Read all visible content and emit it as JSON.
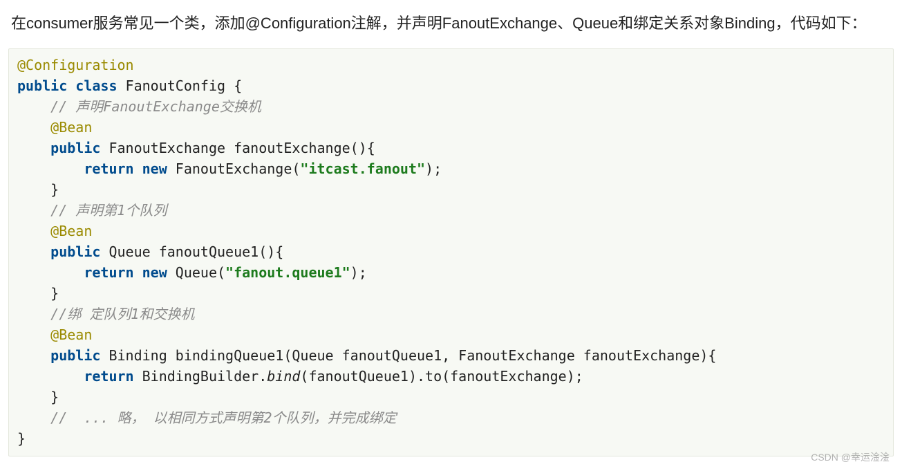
{
  "intro": "在consumer服务常见一个类，添加@Configuration注解，并声明FanoutExchange、Queue和绑定关系对象Binding，代码如下：",
  "code": {
    "l01_anno": "@Configuration",
    "l02_kw1": "public",
    "l02_kw2": "class",
    "l02_rest": " FanoutConfig {",
    "l03_cmt": "    // 声明FanoutExchange交换机",
    "l04_bean": "    @Bean",
    "l05_kw": "    public",
    "l05_rest": " FanoutExchange fanoutExchange(){",
    "l06_kw1": "        return",
    "l06_kw2": " new",
    "l06_mid": " FanoutExchange(",
    "l06_str": "\"itcast.fanout\"",
    "l06_end": ");",
    "l07": "    }",
    "l08_cmt": "    // 声明第1个队列",
    "l09_bean": "    @Bean",
    "l10_kw": "    public",
    "l10_rest": " Queue fanoutQueue1(){",
    "l11_kw1": "        return",
    "l11_kw2": " new",
    "l11_mid": " Queue(",
    "l11_str": "\"fanout.queue1\"",
    "l11_end": ");",
    "l12": "    }",
    "l13_cmt": "    //绑 定队列1和交换机",
    "l14_bean": "    @Bean",
    "l15_kw": "    public",
    "l15_rest": " Binding bindingQueue1(Queue fanoutQueue1, FanoutExchange fanoutExchange){",
    "l16_kw": "        return",
    "l16_mid1": " BindingBuilder.",
    "l16_bind": "bind",
    "l16_mid2": "(fanoutQueue1).to(fanoutExchange);",
    "l17": "    }",
    "l18_cmt": "    //  ... 略， 以相同方式声明第2个队列，并完成绑定",
    "l19": "}"
  },
  "watermark": "CSDN @幸运淦淦"
}
